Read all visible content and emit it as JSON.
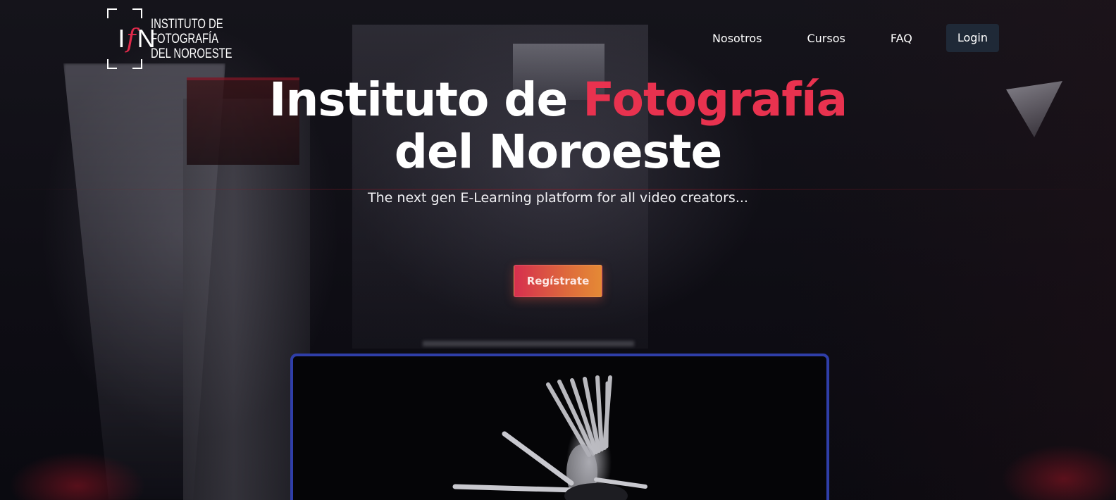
{
  "logo": {
    "mark_left": "I",
    "mark_middle": "f",
    "mark_right": "N",
    "text_lines": [
      "INSTITUTO DE",
      "FOTOGRAFÍA",
      "DEL NOROESTE"
    ]
  },
  "nav": {
    "items": [
      "Nosotros",
      "Cursos",
      "FAQ"
    ],
    "login_label": "Login"
  },
  "hero": {
    "title_part1": "Instituto de ",
    "title_accent": "Fotografía",
    "title_part2": "del Noroeste",
    "subtitle": "The next gen E-Learning platform for all video creators...",
    "cta_label": "Regístrate"
  },
  "colors": {
    "accent": "#e8324f",
    "cta_gradient_start": "#d62f4e",
    "cta_gradient_end": "#e58a35",
    "login_bg": "#1f2937",
    "video_border": "#2f3ea8"
  }
}
